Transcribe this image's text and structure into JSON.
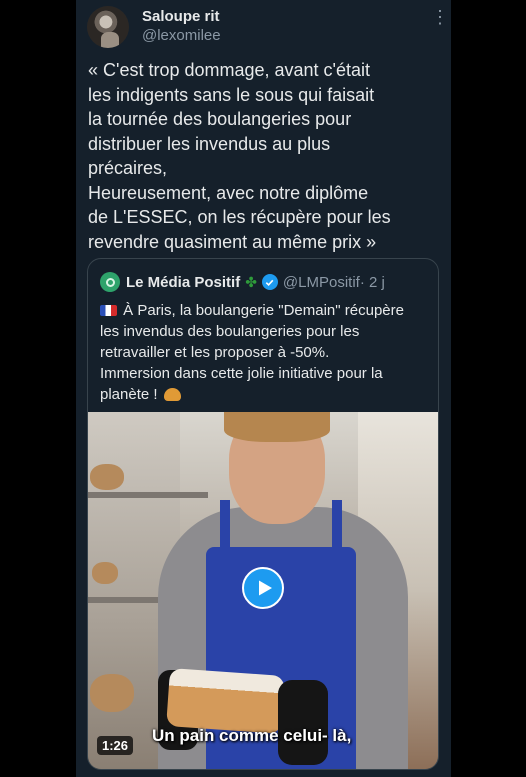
{
  "tweet": {
    "display_name": "Saloupe rit",
    "handle": "@lexomilee",
    "text": "« C'est trop dommage, avant c'était\nles indigents sans le sous qui faisait\nla tournée des boulangeries pour\ndistribuer les invendus au plus\nprécaires,\nHeureusement, avec notre diplôme\nde L'ESSEC, on les récupère pour les\nrevendre quasiment au même prix »"
  },
  "quote": {
    "display_name": "Le Média Positif",
    "handle": "@LMPositif",
    "time": "· 2 j",
    "text": "À Paris, la boulangerie \"Demain\" récupère\nles invendus des boulangeries pour les\nretravailler et les proposer à -50%.\nImmersion dans cette jolie initiative pour la\nplanète !"
  },
  "video": {
    "duration": "1:26",
    "caption": "Un pain comme celui- là,"
  },
  "colors": {
    "background": "#15202b",
    "accent": "#1d9bf0",
    "muted_text": "#8b98a5"
  },
  "icons": {
    "more": "more-dots-icon",
    "verified": "verified-badge-icon",
    "play": "play-icon",
    "flag": "france-flag-emoji",
    "croissant": "croissant-emoji",
    "clover": "four-leaf-clover-emoji"
  }
}
